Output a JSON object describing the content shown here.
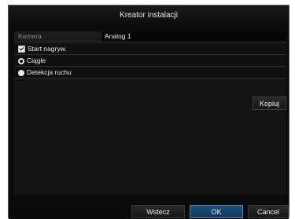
{
  "window": {
    "title": "Kreator instalacji"
  },
  "camera": {
    "label": "Kamera",
    "value": "Analog 1"
  },
  "options": {
    "start_recording": {
      "label": "Start nagryw.",
      "checked": true
    },
    "continuous": {
      "label": "Ciągłe",
      "selected": true
    },
    "motion_detection": {
      "label": "Detekcja ruchu",
      "selected": false
    }
  },
  "buttons": {
    "copy": "Kopiuj",
    "back": "Wstecz",
    "ok": "OK",
    "cancel": "Cancel"
  },
  "colors": {
    "accent": "#1f4e7a",
    "accent_border": "#4a87c0",
    "background": "#0b0b0b"
  }
}
